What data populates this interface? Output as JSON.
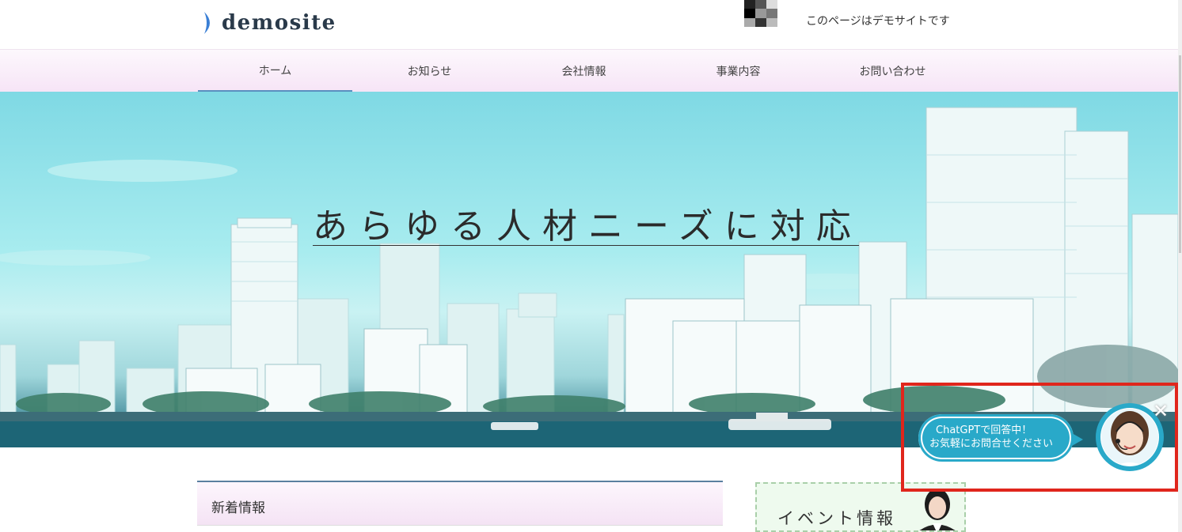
{
  "header": {
    "logo_text": "demosite",
    "tagline": "このページはデモサイトです"
  },
  "nav": {
    "items": [
      {
        "label": "ホーム",
        "active": true
      },
      {
        "label": "お知らせ",
        "active": false
      },
      {
        "label": "会社情報",
        "active": false
      },
      {
        "label": "事業内容",
        "active": false
      },
      {
        "label": "お問い合わせ",
        "active": false
      }
    ]
  },
  "hero": {
    "title": "あらゆる人材ニーズに対応"
  },
  "news": {
    "heading": "新着情報"
  },
  "event": {
    "label": "イベント情報"
  },
  "chat": {
    "line1": "ChatGPTで回答中！",
    "line2": "お気軽にお問合せください",
    "close": "✕"
  },
  "colors": {
    "accent": "#5a8fbf",
    "chat_bubble": "#29a9c9",
    "highlight_border": "#e0261c",
    "nav_bg": "#f6e4f6"
  }
}
